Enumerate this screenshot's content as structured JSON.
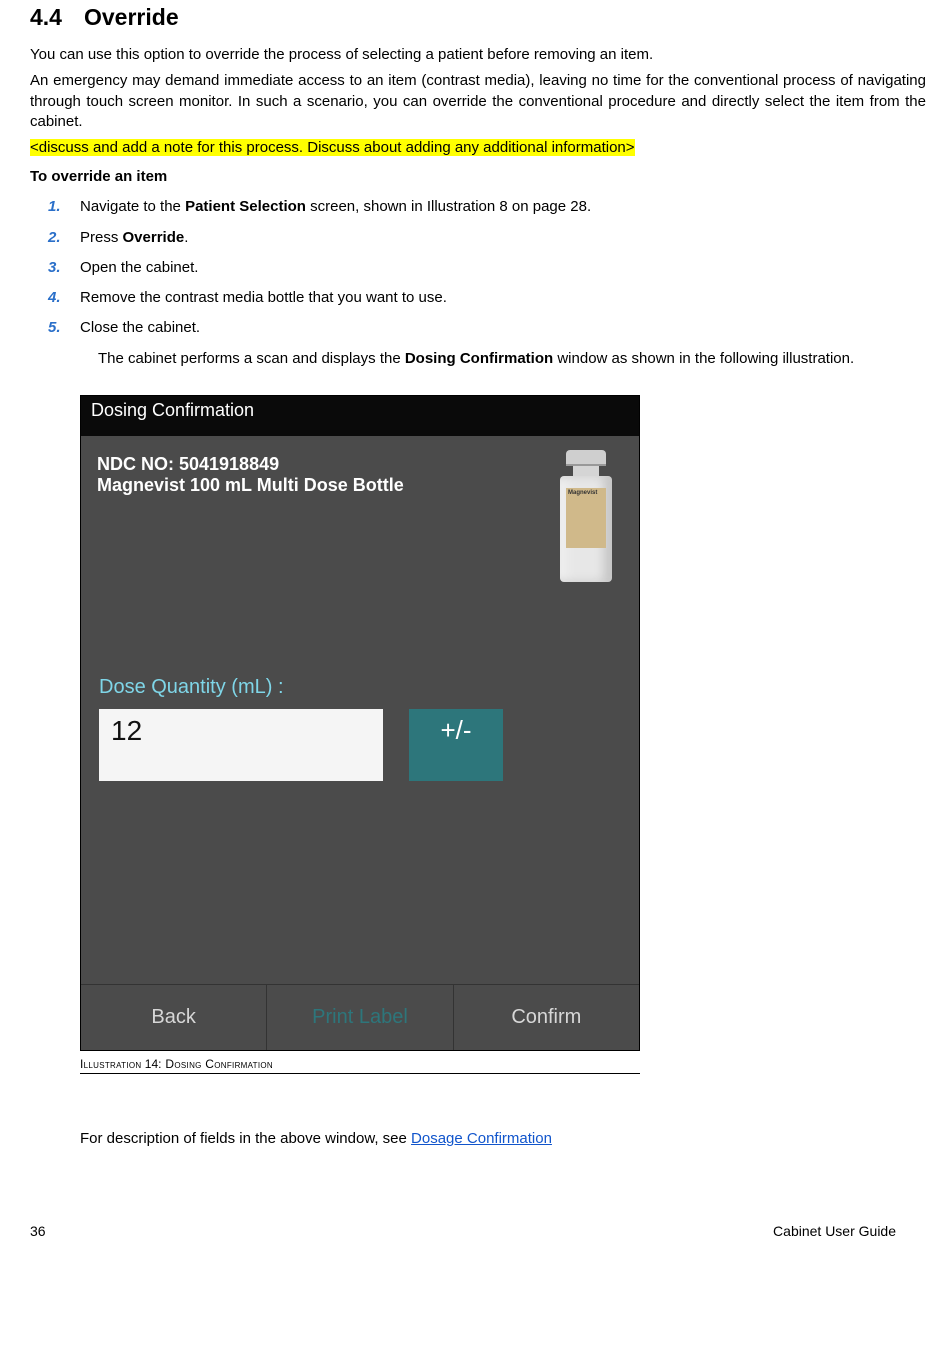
{
  "heading": {
    "num": "4.4",
    "title": "Override"
  },
  "paras": {
    "p1": "You can use this option to override the process of selecting a patient before removing an item.",
    "p2": "An emergency may demand immediate access to an item (contrast media), leaving no time for the conventional process of navigating through touch screen monitor. In such a scenario, you can override the conventional procedure and directly select the item from the cabinet.",
    "note": "<discuss and add a note for this process. Discuss about adding any additional information>",
    "lead": "To override an item"
  },
  "steps": [
    {
      "n": "1.",
      "pre": "Navigate to the ",
      "bold": "Patient Selection",
      "post": " screen, shown  in  Illustration 8 on page 28."
    },
    {
      "n": "2.",
      "pre": "Press ",
      "bold": "Override",
      "post": "."
    },
    {
      "n": "3.",
      "pre": "Open the cabinet.",
      "bold": "",
      "post": ""
    },
    {
      "n": "4.",
      "pre": "Remove the contrast media bottle that you want to use.",
      "bold": "",
      "post": ""
    },
    {
      "n": "5.",
      "pre": "Close the cabinet.",
      "bold": "",
      "post": ""
    }
  ],
  "subtext": {
    "pre": "The cabinet performs a scan and displays the ",
    "bold": "Dosing Confirmation",
    "post": " window as shown in the following illustration."
  },
  "illustration": {
    "title": "Dosing Confirmation",
    "ndc_label": "NDC NO: 5041918849",
    "product": "Magnevist 100 mL Multi Dose Bottle",
    "bottle_tag": "Magnevist",
    "dose_label": "Dose Quantity (mL) :",
    "dose_value": "12",
    "plusminus": "+/-",
    "back": "Back",
    "print": "Print Label",
    "confirm": "Confirm"
  },
  "caption": {
    "pre": "Illustration",
    "num": " 14",
    "post": ": Dosing Confirmation"
  },
  "afterfig": {
    "pre": "For description of fields in the above window, see ",
    "link": "Dosage Confirmation"
  },
  "footer": {
    "page": "36",
    "doc": "Cabinet User Guide"
  }
}
